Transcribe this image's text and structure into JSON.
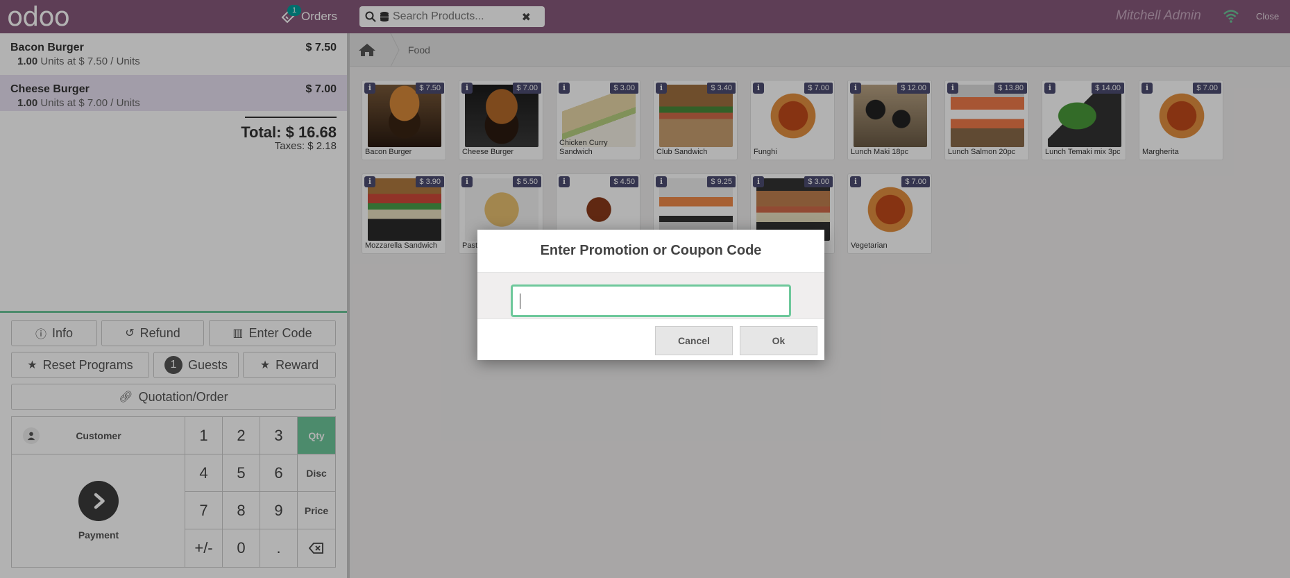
{
  "header": {
    "logo": "odoo",
    "orders_label": "Orders",
    "orders_count": "1",
    "search_placeholder": "Search Products...",
    "user_name": "Mitchell Admin",
    "close_label": "Close",
    "brand_color": "#875a7b"
  },
  "order": {
    "lines": [
      {
        "name": "Bacon Burger",
        "price": "$ 7.50",
        "qty": "1.00",
        "info": " Units at $ 7.50 / Units"
      },
      {
        "name": "Cheese Burger",
        "price": "$ 7.00",
        "qty": "1.00",
        "info": " Units at $ 7.00 / Units"
      }
    ],
    "total": "Total: $ 16.68",
    "taxes": "Taxes: $ 2.18"
  },
  "controls": {
    "info": "Info",
    "refund": "Refund",
    "enter_code": "Enter Code",
    "reset_programs": "Reset Programs",
    "guests_count": "1",
    "guests": "Guests",
    "reward": "Reward",
    "quotation": "Quotation/Order"
  },
  "numpad": {
    "customer": "Customer",
    "payment": "Payment",
    "keys": [
      "1",
      "2",
      "3",
      "4",
      "5",
      "6",
      "7",
      "8",
      "9",
      "+/-",
      "0",
      "."
    ],
    "modes": [
      "Qty",
      "Disc",
      "Price"
    ],
    "active_mode": "Qty",
    "accent": "#6ec89b"
  },
  "breadcrumb": {
    "category": "Food"
  },
  "products": [
    {
      "name": "Bacon Burger",
      "price": "$ 7.50",
      "img": "img-burger"
    },
    {
      "name": "Cheese Burger",
      "price": "$ 7.00",
      "img": "img-burger2"
    },
    {
      "name": "Chicken Curry Sandwich",
      "price": "$ 3.00",
      "img": "img-sandwich"
    },
    {
      "name": "Club Sandwich",
      "price": "$ 3.40",
      "img": "img-club"
    },
    {
      "name": "Funghi",
      "price": "$ 7.00",
      "img": "img-pizza"
    },
    {
      "name": "Lunch Maki 18pc",
      "price": "$ 12.00",
      "img": "img-maki"
    },
    {
      "name": "Lunch Salmon 20pc",
      "price": "$ 13.80",
      "img": "img-salmon"
    },
    {
      "name": "Lunch Temaki mix 3pc",
      "price": "$ 14.00",
      "img": "img-temaki"
    },
    {
      "name": "Margherita",
      "price": "$ 7.00",
      "img": "img-pizza"
    },
    {
      "name": "Mozzarella Sandwich",
      "price": "$ 3.90",
      "img": "img-mozz"
    },
    {
      "name": "Past...",
      "price": "$ 5.50",
      "img": "img-pasta"
    },
    {
      "name": "",
      "price": "$ 4.50",
      "img": "img-dish"
    },
    {
      "name": "",
      "price": "$ 9.25",
      "img": "img-sushi"
    },
    {
      "name": "",
      "price": "$ 3.00",
      "img": "img-panini"
    },
    {
      "name": "Vegetarian",
      "price": "$ 7.00",
      "img": "img-pizza"
    }
  ],
  "modal": {
    "title": "Enter Promotion or Coupon Code",
    "input_value": "",
    "cancel": "Cancel",
    "ok": "Ok"
  }
}
